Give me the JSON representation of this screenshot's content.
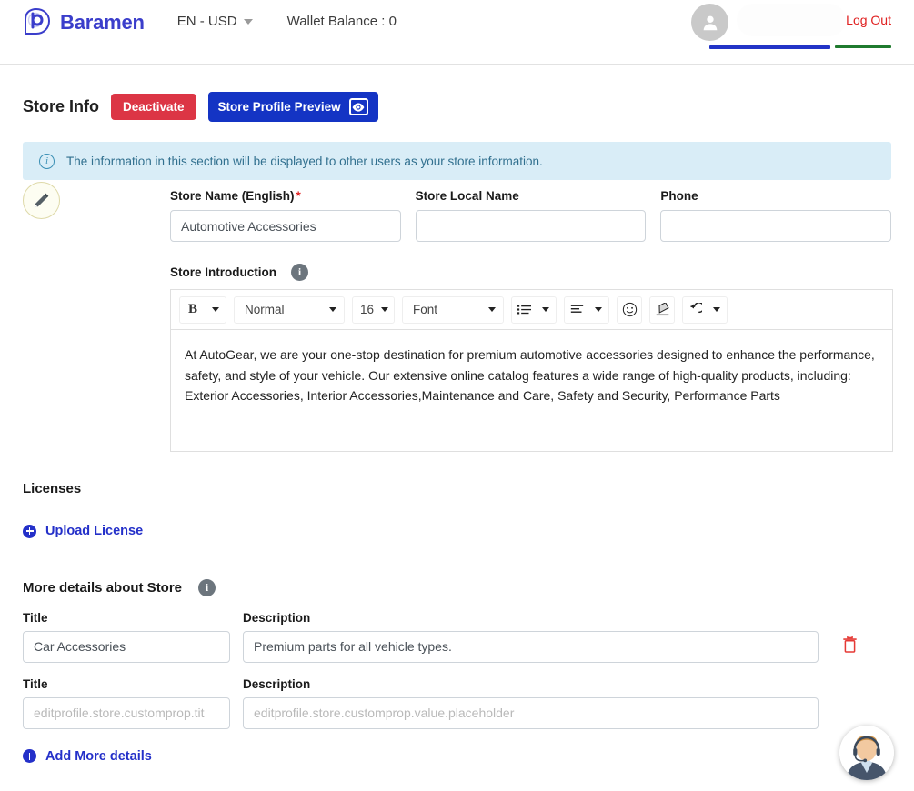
{
  "header": {
    "brand_name": "Baramen",
    "brand_logo_icon": "baramen-b-logo",
    "language_currency": "EN - USD",
    "wallet_label": "Wallet Balance : 0",
    "logout_label": "Log Out",
    "avatar_icon": "user-avatar-icon",
    "accent_blue": "#2234c7",
    "accent_green": "#1f7a2e",
    "logout_color": "#e02020"
  },
  "store_info": {
    "title": "Store Info",
    "deactivate_label": "Deactivate",
    "preview_label": "Store Profile Preview",
    "preview_icon": "eye-icon",
    "deactivate_color": "#dc3545",
    "preview_color": "#1434c4",
    "alert_text": "The information in this section will be displayed to other users as your store information.",
    "alert_icon": "info-circle-icon",
    "alert_bg": "#d9edf7",
    "edit_icon": "pencil-edit-icon"
  },
  "form": {
    "store_name_label": "Store Name (English)",
    "store_name_required": "*",
    "store_name_value": "Automotive Accessories",
    "store_local_name_label": "Store Local Name",
    "store_local_name_value": "",
    "phone_label": "Phone",
    "phone_value": ""
  },
  "introduction": {
    "label": "Store Introduction",
    "info_icon": "info-icon",
    "toolbar": {
      "bold_label": "B",
      "bold_icon": "bold-icon",
      "heading_value": "Normal",
      "size_value": "16",
      "font_value": "Font",
      "list_icon": "bullet-list-icon",
      "align_icon": "align-left-icon",
      "emoji_icon": "emoji-smiley-icon",
      "eraser_icon": "clear-format-eraser-icon",
      "undo_icon": "undo-arrow-icon"
    },
    "body_text": "At AutoGear, we are your one-stop destination for premium automotive accessories designed to enhance the performance, safety, and style of your vehicle. Our extensive online catalog features a wide range of high-quality products, including: Exterior Accessories, Interior Accessories,Maintenance and Care, Safety and Security, Performance Parts"
  },
  "licenses": {
    "title": "Licenses",
    "upload_label": "Upload License",
    "upload_icon": "plus-circle-icon",
    "link_color": "#2430c9"
  },
  "more_details": {
    "title": "More details about Store",
    "info_icon": "info-icon",
    "title_label": "Title",
    "description_label": "Description",
    "rows": [
      {
        "title_value": "Car Accessories",
        "title_placeholder": "",
        "description_value": "Premium parts for all vehicle types.",
        "description_placeholder": "",
        "has_delete": true,
        "delete_icon": "trash-delete-icon"
      },
      {
        "title_value": "",
        "title_placeholder": "editprofile.store.customprop.tit",
        "description_value": "",
        "description_placeholder": "editprofile.store.customprop.value.placeholder",
        "has_delete": false,
        "delete_icon": ""
      }
    ],
    "add_label": "Add More details",
    "add_icon": "plus-circle-icon",
    "delete_color": "#e53935"
  },
  "support": {
    "icon": "support-agent-avatar-icon"
  }
}
